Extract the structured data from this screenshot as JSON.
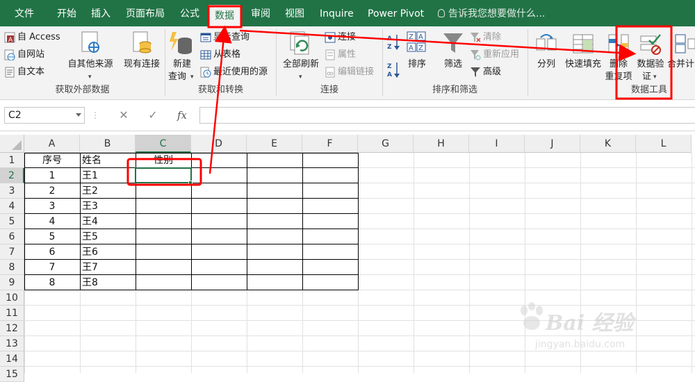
{
  "tabs": [
    "文件",
    "开始",
    "插入",
    "页面布局",
    "公式",
    "数据",
    "审阅",
    "视图",
    "Inquire",
    "Power Pivot"
  ],
  "tell_me": "告诉我您想要做什么...",
  "ribbon": {
    "get_external": {
      "access": "自 Access",
      "web": "自网站",
      "text": "自文本",
      "other": "自其他来源",
      "existing": "现有连接",
      "group": "获取外部数据"
    },
    "get_transform": {
      "new_query_1": "新建",
      "new_query_2": "查询",
      "show_queries": "显示查询",
      "from_table": "从表格",
      "recent": "最近使用的源",
      "group": "获取和转换"
    },
    "connections": {
      "refresh_all": "全部刷新",
      "connections": "连接",
      "properties": "属性",
      "edit_links": "编辑链接",
      "group": "连接"
    },
    "sort_filter": {
      "sort": "排序",
      "filter": "筛选",
      "clear": "清除",
      "reapply": "重新应用",
      "advanced": "高级",
      "group": "排序和筛选"
    },
    "data_tools": {
      "text_to_columns": "分列",
      "flash_fill": "快速填充",
      "remove_dup_1": "删除",
      "remove_dup_2": "重复项",
      "validation_1": "数据验",
      "validation_2": "证",
      "consolidate": "合并计",
      "group": "数据工具"
    }
  },
  "formula_bar": {
    "name_box": "C2",
    "cancel": "✕",
    "enter": "✓",
    "fx": "fx",
    "formula": ""
  },
  "sheet": {
    "columns": [
      "A",
      "B",
      "C",
      "D",
      "E",
      "F",
      "G",
      "H",
      "I",
      "J",
      "K",
      "L"
    ],
    "rows": [
      "1",
      "2",
      "3",
      "4",
      "5",
      "6",
      "7",
      "8",
      "9",
      "10",
      "11",
      "12",
      "13",
      "14",
      "15"
    ],
    "headers": [
      "序号",
      "姓名",
      "性别"
    ],
    "data": [
      [
        "1",
        "王1"
      ],
      [
        "2",
        "王2"
      ],
      [
        "3",
        "王3"
      ],
      [
        "4",
        "王4"
      ],
      [
        "5",
        "王5"
      ],
      [
        "6",
        "王6"
      ],
      [
        "7",
        "王7"
      ],
      [
        "8",
        "王8"
      ]
    ],
    "selected_cell": "C2"
  },
  "watermark": {
    "brand": "Bai 经验",
    "url": "jingyan.baidu.com"
  },
  "colors": {
    "excel_green": "#217346",
    "annotation_red": "#ff0000"
  }
}
